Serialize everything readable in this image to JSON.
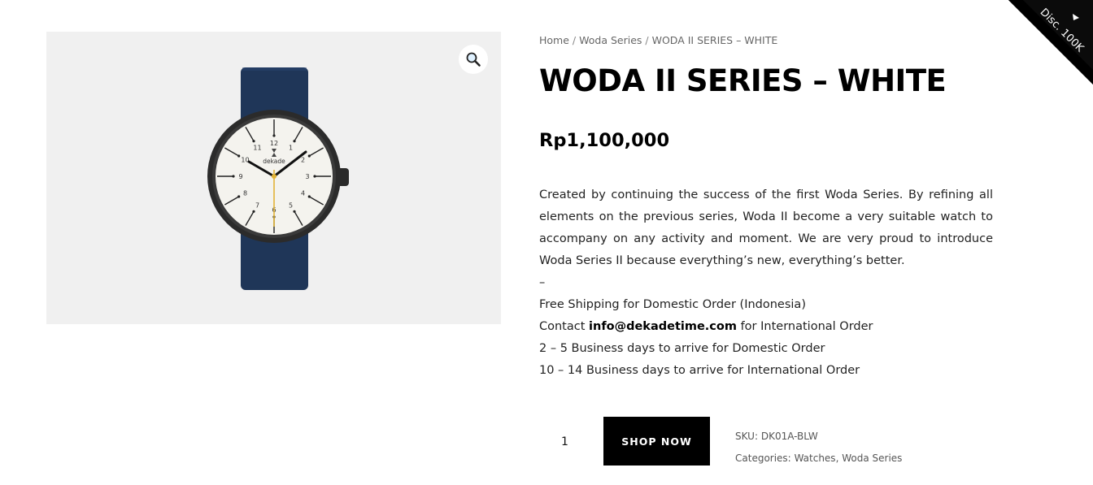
{
  "gallery": {
    "zoom_icon": "magnifier-icon",
    "image_alt": "Woda II Series – White watch"
  },
  "breadcrumb": {
    "home": "Home",
    "category": "Woda Series",
    "current": "WODA II SERIES – WHITE",
    "separator": "/"
  },
  "product": {
    "title": "WODA II SERIES – WHITE",
    "price": "Rp1,100,000"
  },
  "description": {
    "paragraph": "Created by continuing the success of the first Woda Series. By refining all elements on the previous series, Woda II become a very suitable watch to accompany on any activity and moment. We are very proud to introduce Woda Series II because everything’s new, everything’s better.",
    "dash": "–",
    "shipping": "Free Shipping for Domestic Order (Indonesia)",
    "contact_prefix": "Contact",
    "contact_email": "info@dekadetime.com",
    "contact_suffix": "for International Order",
    "domestic_delivery": "2 – 5 Business days to arrive for Domestic Order",
    "international_delivery": "10 – 14 Business days to arrive for International Order"
  },
  "cart": {
    "quantity": "1",
    "button_label": "SHOP NOW"
  },
  "meta": {
    "sku_label": "SKU:",
    "sku_value": "DK01A-BLW",
    "categories_label": "Categories:",
    "category_1": "Watches",
    "category_sep": ",",
    "category_2": "Woda Series"
  },
  "ribbon": {
    "text": "Disc. 100K",
    "icon": "triangle-arrow-icon"
  },
  "watch": {
    "brand": "dekade",
    "numerals": [
      "12",
      "1",
      "2",
      "3",
      "4",
      "5",
      "6",
      "7",
      "8",
      "9",
      "10",
      "11"
    ],
    "colors": {
      "strap": "#1f3658",
      "case": "#2b2b2b",
      "dial": "#f4f3ee",
      "second_hand": "#e2b437"
    }
  }
}
